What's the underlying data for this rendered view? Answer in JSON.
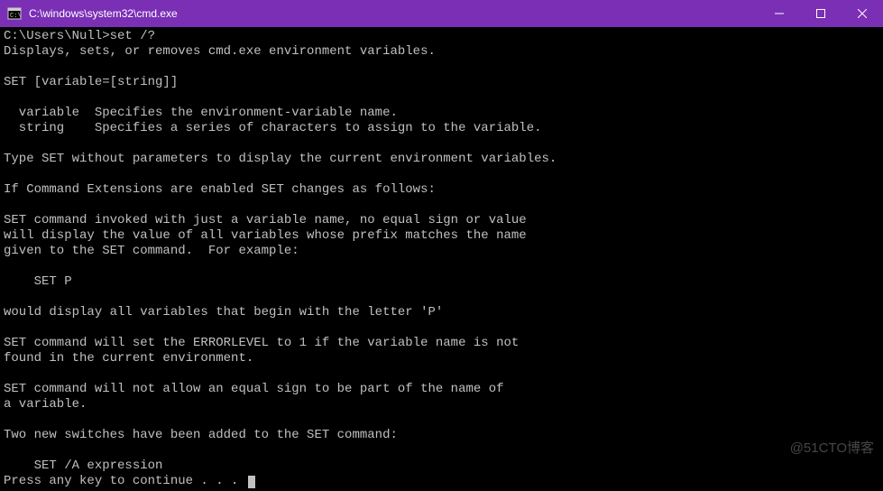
{
  "titlebar": {
    "title": "C:\\windows\\system32\\cmd.exe"
  },
  "terminal": {
    "prompt": "C:\\Users\\Null>",
    "command": "set /?",
    "output": "Displays, sets, or removes cmd.exe environment variables.\n\nSET [variable=[string]]\n\n  variable  Specifies the environment-variable name.\n  string    Specifies a series of characters to assign to the variable.\n\nType SET without parameters to display the current environment variables.\n\nIf Command Extensions are enabled SET changes as follows:\n\nSET command invoked with just a variable name, no equal sign or value\nwill display the value of all variables whose prefix matches the name\ngiven to the SET command.  For example:\n\n    SET P\n\nwould display all variables that begin with the letter 'P'\n\nSET command will set the ERRORLEVEL to 1 if the variable name is not\nfound in the current environment.\n\nSET command will not allow an equal sign to be part of the name of\na variable.\n\nTwo new switches have been added to the SET command:\n\n    SET /A expression",
    "continue_prompt": "Press any key to continue . . . "
  },
  "watermark": "@51CTO博客"
}
